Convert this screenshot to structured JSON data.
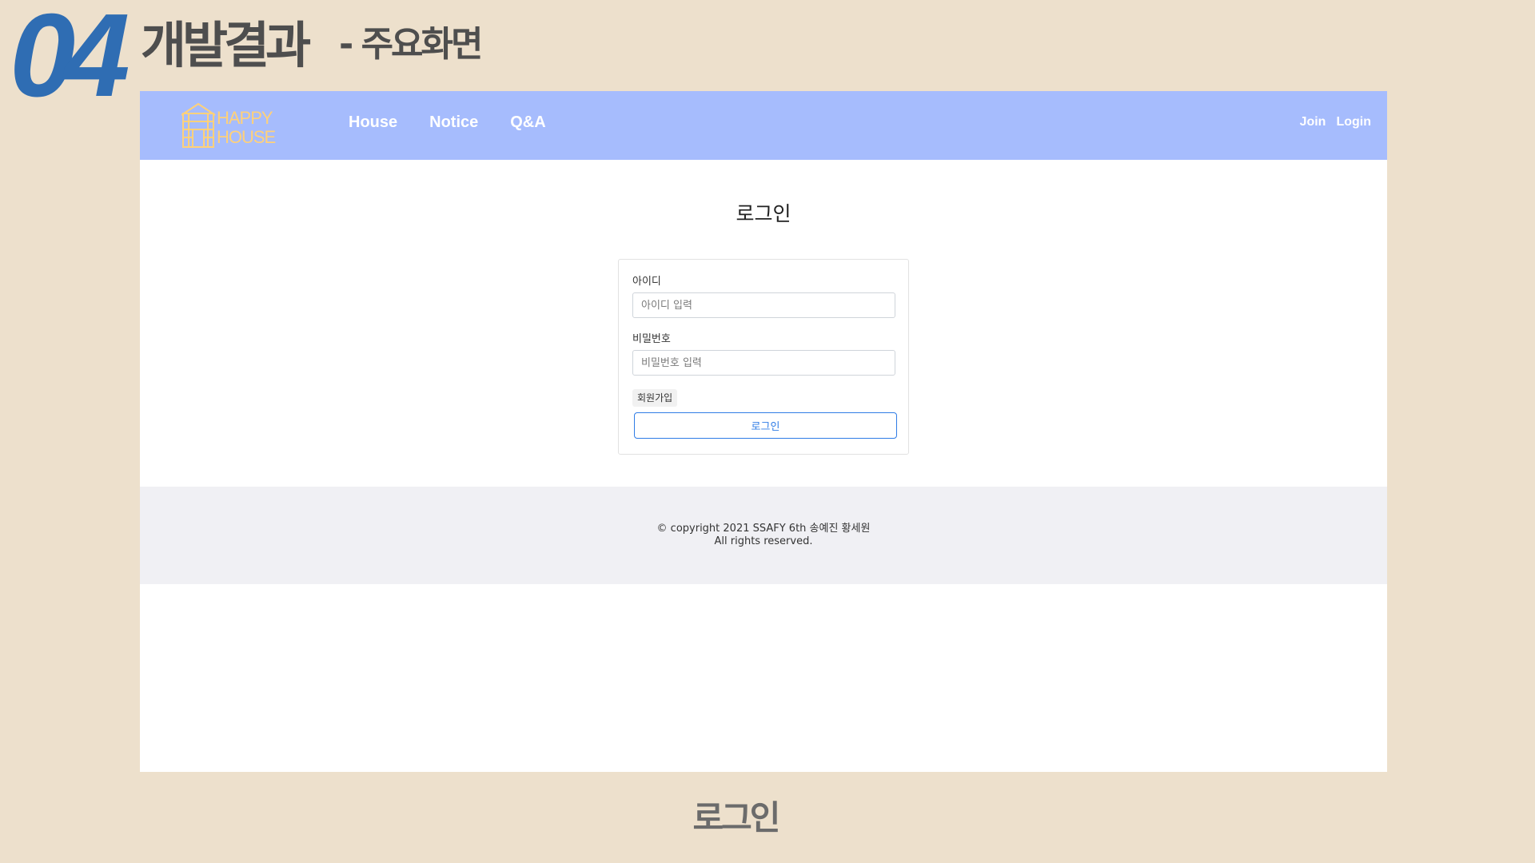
{
  "slide": {
    "number": "04",
    "title": "개발결과",
    "subtitle": "- 주요화면",
    "caption": "로그인"
  },
  "navbar": {
    "logo_alt": "HAPPY HOUSE",
    "logo_line1": "HAPPY",
    "logo_line2": "HOUSE",
    "links": [
      "House",
      "Notice",
      "Q&A"
    ],
    "right_links": [
      "Join",
      "Login"
    ]
  },
  "login": {
    "heading": "로그인",
    "id_label": "아이디",
    "id_placeholder": "아이디 입력",
    "pw_label": "비밀번호",
    "pw_placeholder": "비밀번호 입력",
    "join_label": "회원가입",
    "login_label": "로그인"
  },
  "footer": {
    "line1": "© copyright 2021 SSAFY 6th 송예진 황세원",
    "line2": "All rights reserved."
  },
  "colors": {
    "slide_bg": "#ede0cc",
    "accent_blue": "#2f6db3",
    "navbar_bg": "#a6bcfd",
    "logo_color": "#ffd17a",
    "primary": "#2f7ce6",
    "footer_bg": "#f0f0f4"
  }
}
